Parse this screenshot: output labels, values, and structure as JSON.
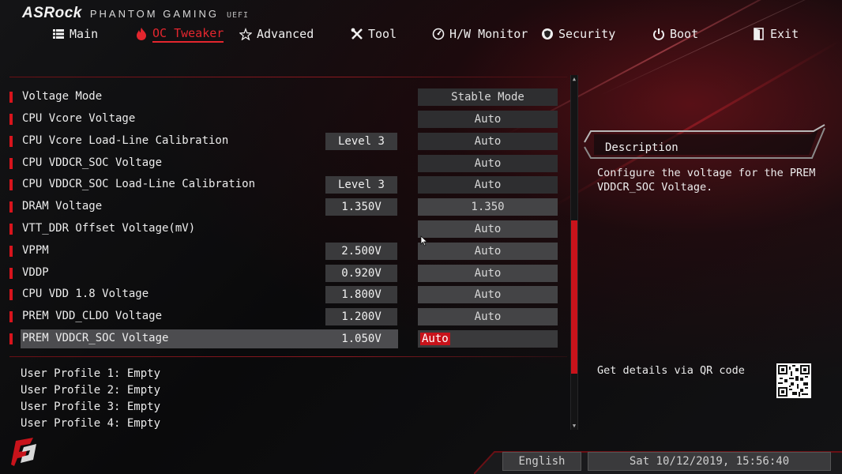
{
  "brand": {
    "name": "ASRock",
    "subtitle": "PHANTOM GAMING",
    "uefi": "UEFI"
  },
  "colors": {
    "accent": "#e3262e",
    "marker": "#d8141c",
    "background": "#0b0b0c",
    "field": "#3a3a3c"
  },
  "nav": [
    {
      "label": "Main",
      "icon": "list-icon",
      "active": false
    },
    {
      "label": "OC Tweaker",
      "icon": "flame-icon",
      "active": true
    },
    {
      "label": "Advanced",
      "icon": "star-icon",
      "active": false
    },
    {
      "label": "Tool",
      "icon": "tools-icon",
      "active": false
    },
    {
      "label": "H/W Monitor",
      "icon": "monitor-gauge-icon",
      "active": false
    },
    {
      "label": "Security",
      "icon": "shield-icon",
      "active": false
    },
    {
      "label": "Boot",
      "icon": "power-icon",
      "active": false
    },
    {
      "label": "Exit",
      "icon": "exit-door-icon",
      "active": false
    }
  ],
  "settings": [
    {
      "label": "Voltage Mode",
      "current": "",
      "value": "Stable Mode"
    },
    {
      "label": "CPU Vcore Voltage",
      "current": "",
      "value": "Auto"
    },
    {
      "label": "CPU Vcore Load-Line Calibration",
      "current": "Level 3",
      "value": "Auto"
    },
    {
      "label": "CPU VDDCR_SOC Voltage",
      "current": "",
      "value": "Auto"
    },
    {
      "label": "CPU VDDCR_SOC Load-Line Calibration",
      "current": "Level 3",
      "value": "Auto"
    },
    {
      "label": "DRAM Voltage",
      "current": "1.350V",
      "value": "1.350"
    },
    {
      "label": "VTT_DDR Offset Voltage(mV)",
      "current": "",
      "value": "Auto"
    },
    {
      "label": "VPPM",
      "current": "2.500V",
      "value": "Auto"
    },
    {
      "label": "VDDP",
      "current": "0.920V",
      "value": "Auto"
    },
    {
      "label": "CPU VDD 1.8 Voltage",
      "current": "1.800V",
      "value": "Auto"
    },
    {
      "label": "PREM VDD_CLDO Voltage",
      "current": "1.200V",
      "value": "Auto"
    },
    {
      "label": "PREM VDDCR_SOC Voltage",
      "current": "1.050V",
      "value": "Auto"
    }
  ],
  "profiles": [
    "User Profile 1: Empty",
    "User Profile 2: Empty",
    "User Profile 3: Empty",
    "User Profile 4: Empty"
  ],
  "description": {
    "title": "Description",
    "text": "Configure the voltage for the PREM VDDCR_SOC Voltage."
  },
  "qr": {
    "label": "Get details via QR code"
  },
  "footer": {
    "language": "English",
    "datetime": "Sat 10/12/2019, 15:56:40"
  }
}
